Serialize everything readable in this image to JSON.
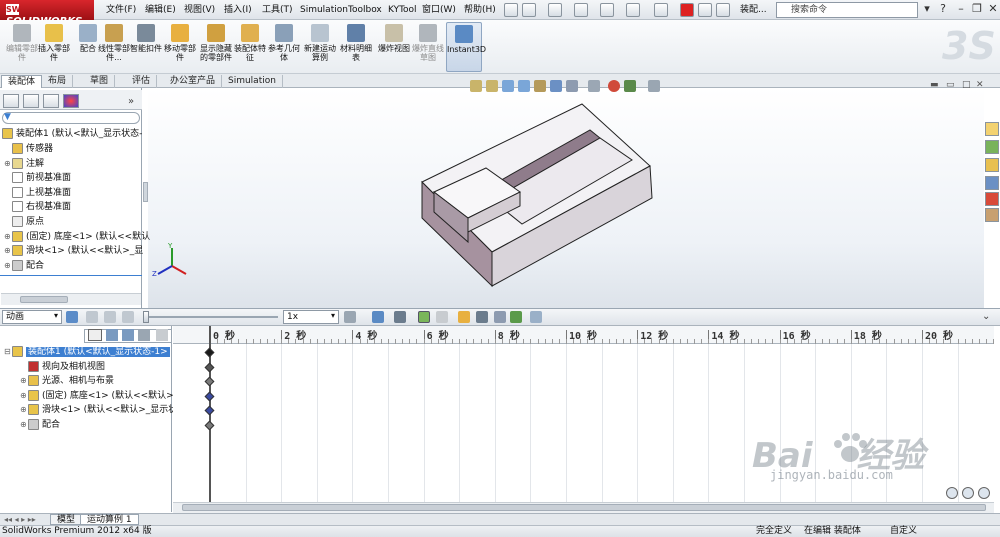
{
  "app": {
    "logo": "SOLIDWORKS",
    "title": "装配...",
    "search_placeholder": "搜索命令"
  },
  "menus": [
    "文件(F)",
    "编辑(E)",
    "视图(V)",
    "插入(I)",
    "工具(T)",
    "Simulation",
    "Toolbox",
    "KYTool",
    "窗口(W)",
    "帮助(H)"
  ],
  "ribbon": {
    "buttons": [
      {
        "label": "编辑零部件",
        "icon": "edit-component-icon",
        "disabled": true
      },
      {
        "label": "插入零部件",
        "icon": "insert-component-icon"
      },
      {
        "label": "配合",
        "icon": "mate-icon"
      },
      {
        "label": "线性零部件...",
        "icon": "linear-pattern-icon"
      },
      {
        "label": "智能扣件",
        "icon": "smart-fastener-icon"
      },
      {
        "label": "移动零部件",
        "icon": "move-component-icon"
      },
      {
        "label": "显示隐藏的零部件",
        "icon": "show-hidden-icon"
      },
      {
        "label": "装配体特征",
        "icon": "assembly-feature-icon"
      },
      {
        "label": "参考几何体",
        "icon": "reference-geometry-icon"
      },
      {
        "label": "新建运动算例",
        "icon": "new-motion-study-icon"
      },
      {
        "label": "材料明细表",
        "icon": "bom-icon"
      },
      {
        "label": "爆炸视图",
        "icon": "exploded-view-icon"
      },
      {
        "label": "爆炸直线草图",
        "icon": "explode-line-sketch-icon",
        "disabled": true
      },
      {
        "label": "Instant3D",
        "icon": "instant3d-icon"
      }
    ]
  },
  "command_tabs": [
    "装配体",
    "布局",
    "草图",
    "评估",
    "办公室产品",
    "Simulation"
  ],
  "feature_tree": {
    "root": "装配体1 (默认<默认_显示状态-",
    "items": [
      {
        "label": "传感器",
        "icon": "sensor-icon"
      },
      {
        "label": "注解",
        "icon": "annotation-icon",
        "expandable": true
      },
      {
        "label": "前视基准面",
        "icon": "plane-icon"
      },
      {
        "label": "上视基准面",
        "icon": "plane-icon"
      },
      {
        "label": "右视基准面",
        "icon": "plane-icon"
      },
      {
        "label": "原点",
        "icon": "origin-icon"
      },
      {
        "label": "(固定) 底座<1> (默认<<默认",
        "icon": "part-icon",
        "expandable": true
      },
      {
        "label": "滑块<1> (默认<<默认>_显",
        "icon": "part-icon",
        "expandable": true
      },
      {
        "label": "配合",
        "icon": "mates-icon",
        "expandable": true
      }
    ]
  },
  "motion_manager": {
    "study_type": "动画",
    "playback_speed": "1x",
    "tree": {
      "root": "装配体1 (默认<默认_显示状态-1>",
      "items": [
        {
          "label": "视向及相机视图",
          "icon": "camera-view-icon"
        },
        {
          "label": "光源、相机与布景",
          "icon": "lights-icon",
          "expandable": true
        },
        {
          "label": "(固定) 底座<1> (默认<<默认>",
          "icon": "part-icon",
          "expandable": true
        },
        {
          "label": "滑块<1> (默认<<默认>_显示状",
          "icon": "part-icon",
          "expandable": true
        },
        {
          "label": "配合",
          "icon": "mates-icon",
          "expandable": true
        }
      ]
    },
    "timeline_labels": [
      "0 秒",
      "2 秒",
      "4 秒",
      "6 秒",
      "8 秒",
      "10 秒",
      "12 秒",
      "14 秒",
      "16 秒",
      "18 秒",
      "20 秒"
    ],
    "key_colors": [
      "#1a1a1a",
      "#555555",
      "#7a7a7a",
      "#3a4aa0",
      "#3a4aa0",
      "#7a7a7a"
    ]
  },
  "bottom_tabs": [
    "模型",
    "运动算例 1"
  ],
  "status": {
    "left": "SolidWorks Premium 2012 x64 版",
    "state1": "完全定义",
    "state2": "在编辑 装配体",
    "state3": "自定义"
  },
  "watermark": {
    "brand": "Bai",
    "brand2": "经验",
    "url": "jingyan.baidu.com"
  },
  "colors": {
    "accent": "#c0161c",
    "selection": "#3d7fd1",
    "model_top": "#f4f3f6",
    "model_side": "#9f8c9d"
  }
}
